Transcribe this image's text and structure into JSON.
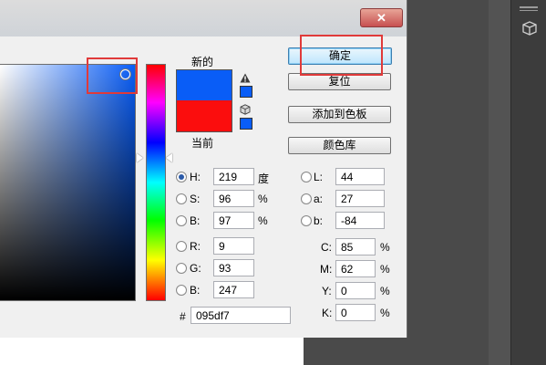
{
  "window": {
    "close_label": "✕"
  },
  "preview": {
    "new_label": "新的",
    "current_label": "当前",
    "new_color": "#095df7",
    "current_color": "#fb0d0d"
  },
  "buttons": {
    "ok": "确定",
    "reset": "复位",
    "add_to_swatches": "添加到色板",
    "color_libraries": "颜色库"
  },
  "hsb": {
    "h": {
      "label": "H:",
      "value": "219",
      "unit": "度"
    },
    "s": {
      "label": "S:",
      "value": "96",
      "unit": "%"
    },
    "b": {
      "label": "B:",
      "value": "97",
      "unit": "%"
    }
  },
  "rgb": {
    "r": {
      "label": "R:",
      "value": "9"
    },
    "g": {
      "label": "G:",
      "value": "93"
    },
    "b": {
      "label": "B:",
      "value": "247"
    }
  },
  "lab": {
    "l": {
      "label": "L:",
      "value": "44"
    },
    "a": {
      "label": "a:",
      "value": "27"
    },
    "b": {
      "label": "b:",
      "value": "-84"
    }
  },
  "cmyk": {
    "c": {
      "label": "C:",
      "value": "85",
      "unit": "%"
    },
    "m": {
      "label": "M:",
      "value": "62",
      "unit": "%"
    },
    "y": {
      "label": "Y:",
      "value": "0",
      "unit": "%"
    },
    "k": {
      "label": "K:",
      "value": "0",
      "unit": "%"
    }
  },
  "hex": {
    "label": "#",
    "value": "095df7"
  },
  "colors": {
    "accent_annotation": "#e03a3a",
    "selected_color": "#095df7"
  }
}
